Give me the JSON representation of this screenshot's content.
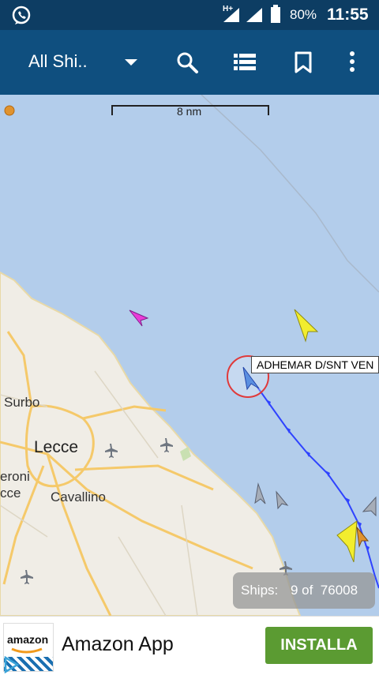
{
  "status_bar": {
    "battery": "80%",
    "time": "11:55",
    "network_type": "H+"
  },
  "app_bar": {
    "title": "All Shi.."
  },
  "map": {
    "scale_label": "8 nm",
    "places": [
      "Surbo",
      "Lecce",
      "Cavallino",
      "eroni",
      "cce"
    ],
    "vessel_label": "ADHEMAR D/SNT VEN"
  },
  "ships_counter": {
    "label": "Ships:",
    "value": "9 of  76008"
  },
  "ad": {
    "brand": "amazon",
    "title": "Amazon App",
    "button": "INSTALLA"
  }
}
